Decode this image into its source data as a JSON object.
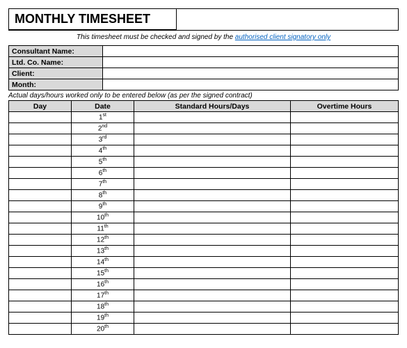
{
  "title": "MONTHLY TIMESHEET",
  "note_prefix": "This timesheet must be checked and signed by the ",
  "note_link": "authorised client signatory only",
  "fields": {
    "consultant_label": "Consultant Name:",
    "consultant_value": "",
    "ltd_label": "Ltd. Co. Name:",
    "ltd_value": "",
    "client_label": "Client:",
    "client_value": "",
    "month_label": "Month:",
    "month_value": ""
  },
  "instruction": "Actual days/hours worked only to be entered below (as per the signed contract)",
  "columns": {
    "day": "Day",
    "date": "Date",
    "std": "Standard Hours/Days",
    "ot": "Overtime Hours"
  },
  "rows": [
    {
      "day": "",
      "date_num": "1",
      "date_suf": "st",
      "std": "",
      "ot": ""
    },
    {
      "day": "",
      "date_num": "2",
      "date_suf": "nd",
      "std": "",
      "ot": ""
    },
    {
      "day": "",
      "date_num": "3",
      "date_suf": "rd",
      "std": "",
      "ot": ""
    },
    {
      "day": "",
      "date_num": "4",
      "date_suf": "th",
      "std": "",
      "ot": ""
    },
    {
      "day": "",
      "date_num": "5",
      "date_suf": "th",
      "std": "",
      "ot": ""
    },
    {
      "day": "",
      "date_num": "6",
      "date_suf": "th",
      "std": "",
      "ot": ""
    },
    {
      "day": "",
      "date_num": "7",
      "date_suf": "th",
      "std": "",
      "ot": ""
    },
    {
      "day": "",
      "date_num": "8",
      "date_suf": "th",
      "std": "",
      "ot": ""
    },
    {
      "day": "",
      "date_num": "9",
      "date_suf": "th",
      "std": "",
      "ot": ""
    },
    {
      "day": "",
      "date_num": "10",
      "date_suf": "th",
      "std": "",
      "ot": ""
    },
    {
      "day": "",
      "date_num": "11",
      "date_suf": "th",
      "std": "",
      "ot": ""
    },
    {
      "day": "",
      "date_num": "12",
      "date_suf": "th",
      "std": "",
      "ot": ""
    },
    {
      "day": "",
      "date_num": "13",
      "date_suf": "th",
      "std": "",
      "ot": ""
    },
    {
      "day": "",
      "date_num": "14",
      "date_suf": "th",
      "std": "",
      "ot": ""
    },
    {
      "day": "",
      "date_num": "15",
      "date_suf": "th",
      "std": "",
      "ot": ""
    },
    {
      "day": "",
      "date_num": "16",
      "date_suf": "th",
      "std": "",
      "ot": ""
    },
    {
      "day": "",
      "date_num": "17",
      "date_suf": "th",
      "std": "",
      "ot": ""
    },
    {
      "day": "",
      "date_num": "18",
      "date_suf": "th",
      "std": "",
      "ot": ""
    },
    {
      "day": "",
      "date_num": "19",
      "date_suf": "th",
      "std": "",
      "ot": ""
    },
    {
      "day": "",
      "date_num": "20",
      "date_suf": "th",
      "std": "",
      "ot": ""
    }
  ]
}
